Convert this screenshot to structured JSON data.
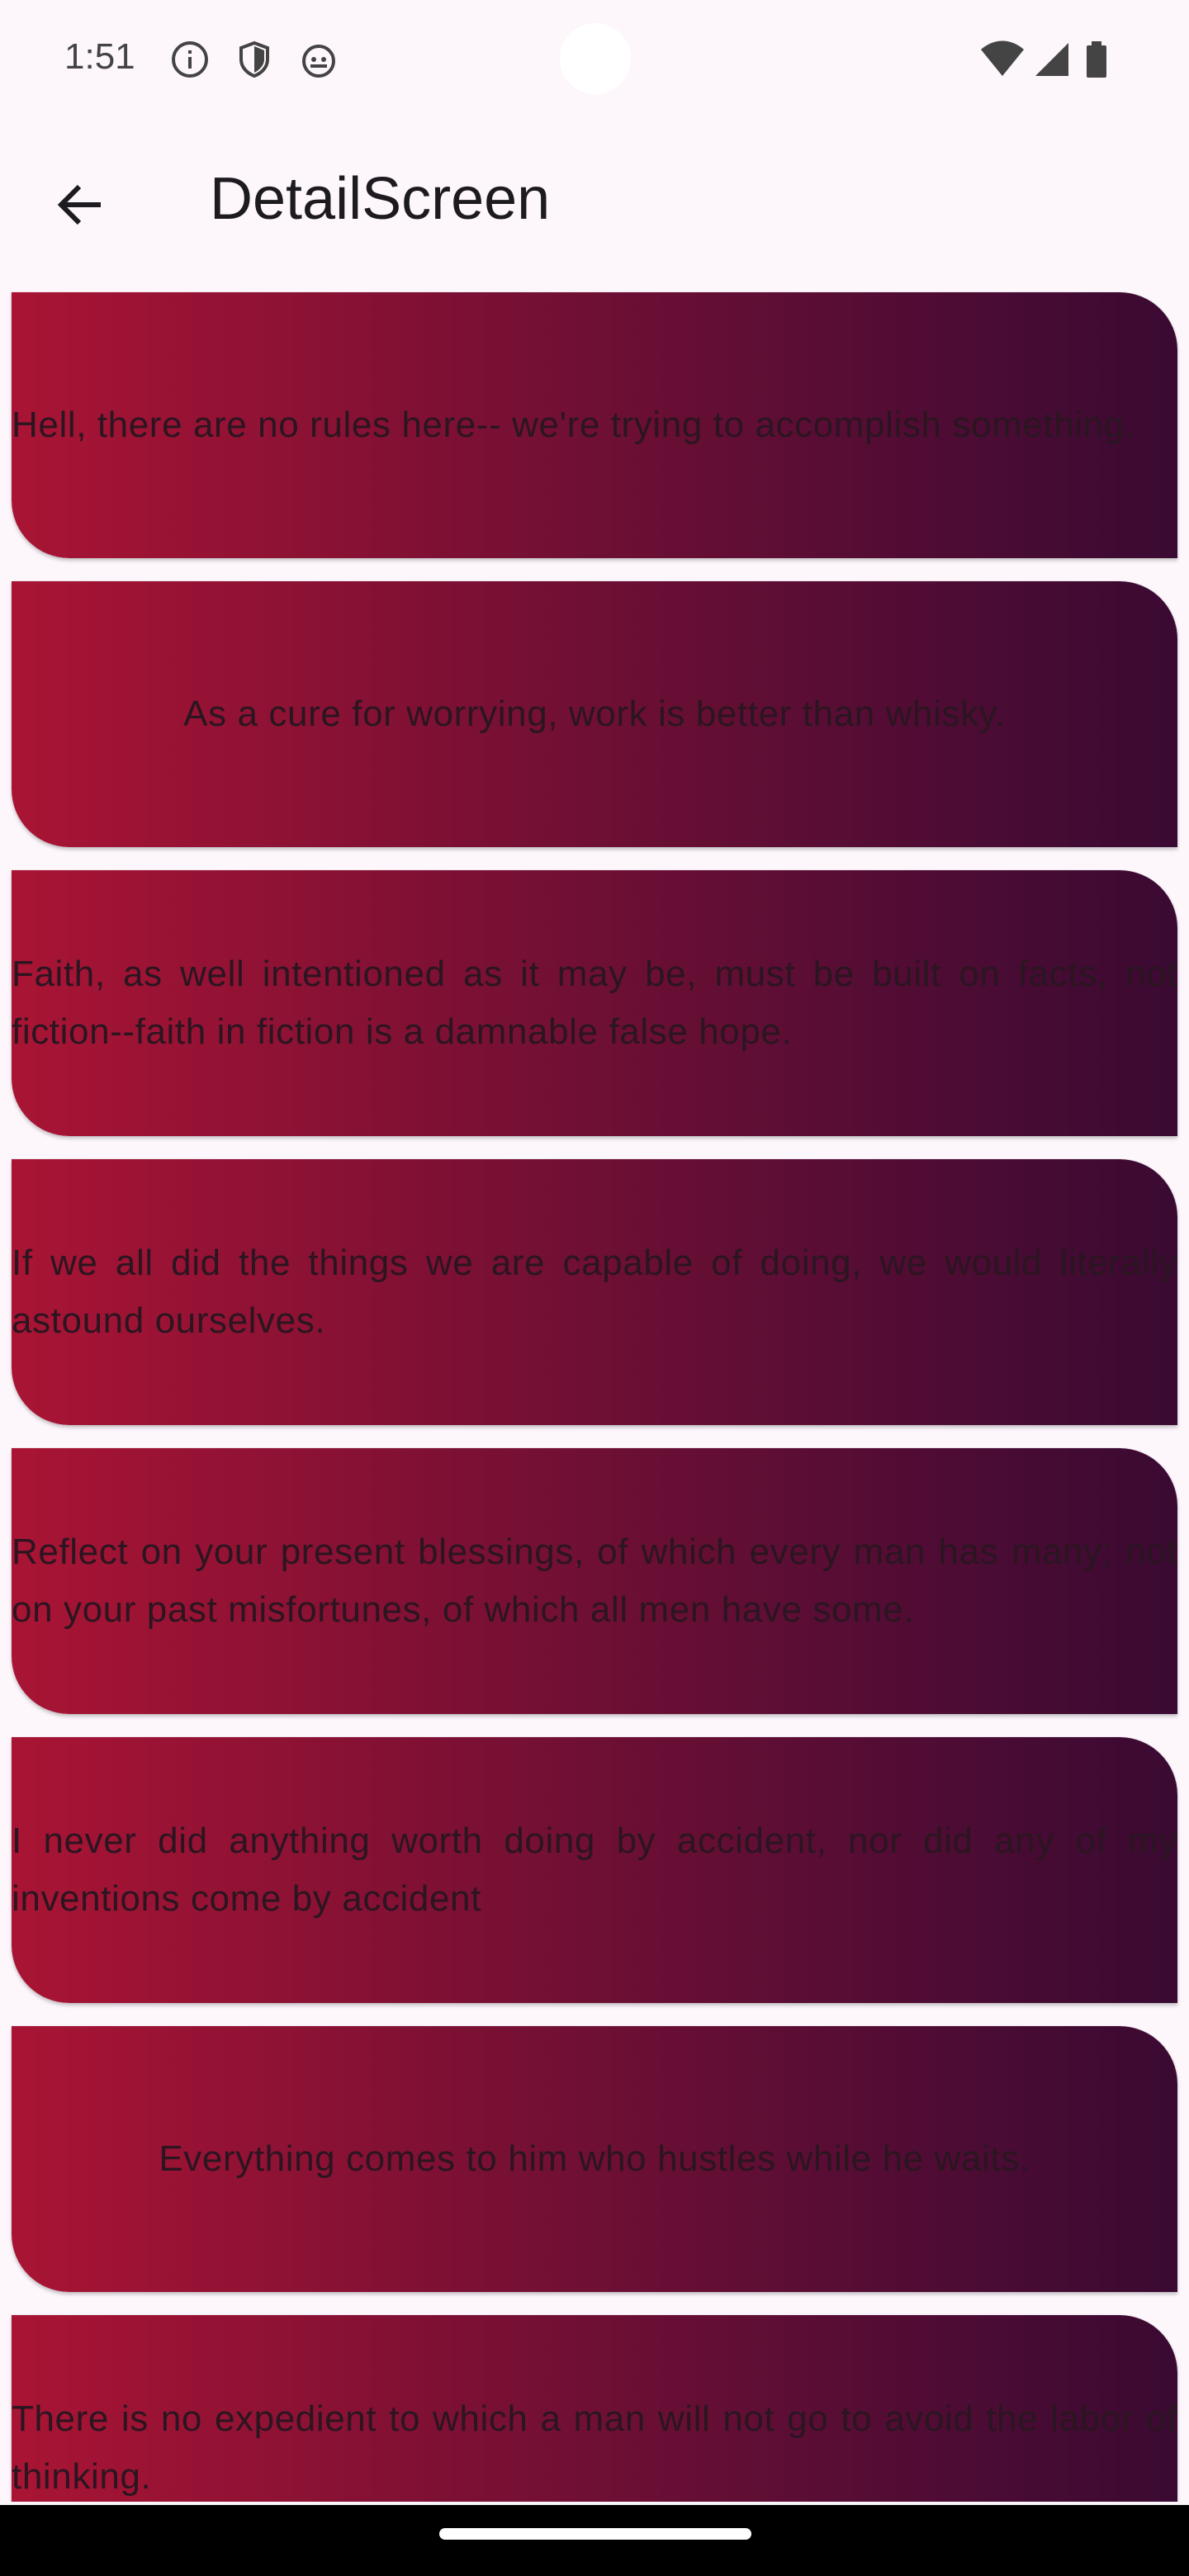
{
  "status_bar": {
    "time": "1:51",
    "left_icons": [
      "info-icon",
      "shield-icon",
      "android-icon"
    ],
    "right_icons": [
      "wifi-icon",
      "signal-icon",
      "battery-icon"
    ]
  },
  "app_bar": {
    "back_icon": "arrow-back-icon",
    "title": "DetailScreen"
  },
  "colors": {
    "background": "#fdf7fc",
    "card_gradient_start": "#a91434",
    "card_gradient_end": "#3a0a32",
    "card_text": "#2a1520"
  },
  "quotes": [
    {
      "text": "Hell, there are no rules here-- we're trying to accomplish something.",
      "align": "justify"
    },
    {
      "text": "As a cure for worrying, work is better than whisky.",
      "align": "center"
    },
    {
      "text": "Faith, as well intentioned as it may be, must be built on facts, not fiction--faith in fiction is a damnable false hope.",
      "align": "justify"
    },
    {
      "text": "If we all did the things we are capable of doing, we would literally astound ourselves.",
      "align": "justify"
    },
    {
      "text": "Reflect on your present blessings, of which every man has many; not on your past misfortunes, of which all men have some.",
      "align": "justify"
    },
    {
      "text": "I never did anything worth doing by accident, nor did any of my inventions come by accident",
      "align": "justify"
    },
    {
      "text": "Everything comes to him who hustles while he waits.",
      "align": "center"
    },
    {
      "text": "There is no expedient to which a man will not go to avoid the labor of thinking.",
      "align": "justify"
    }
  ]
}
